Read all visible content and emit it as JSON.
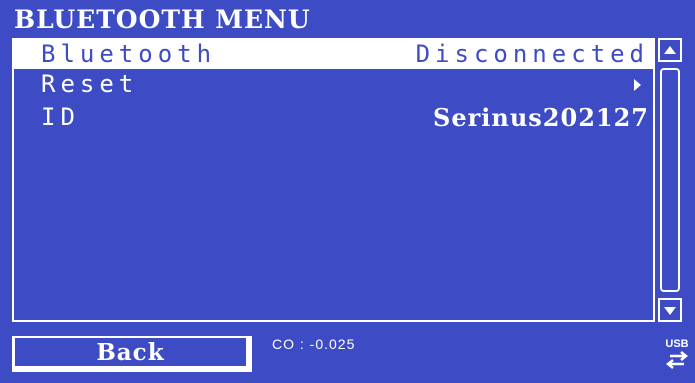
{
  "header": {
    "title": "BLUETOOTH MENU"
  },
  "menu": {
    "items": [
      {
        "label": "Bluetooth",
        "value": "Disconnected",
        "selected": true
      },
      {
        "label": "Reset",
        "value": "",
        "has_submenu": true
      },
      {
        "label": "ID",
        "value": "Serinus202127"
      }
    ]
  },
  "footer": {
    "back_label": "Back",
    "status_text": "CO : -0.025",
    "usb_label": "USB"
  },
  "icons": {
    "scroll_up": "arrow-up-icon",
    "scroll_down": "arrow-down-icon",
    "submenu": "chevron-right-icon",
    "usb": "usb-connection-icon"
  },
  "colors": {
    "background": "#3d4cc4",
    "foreground": "#ffffff"
  }
}
